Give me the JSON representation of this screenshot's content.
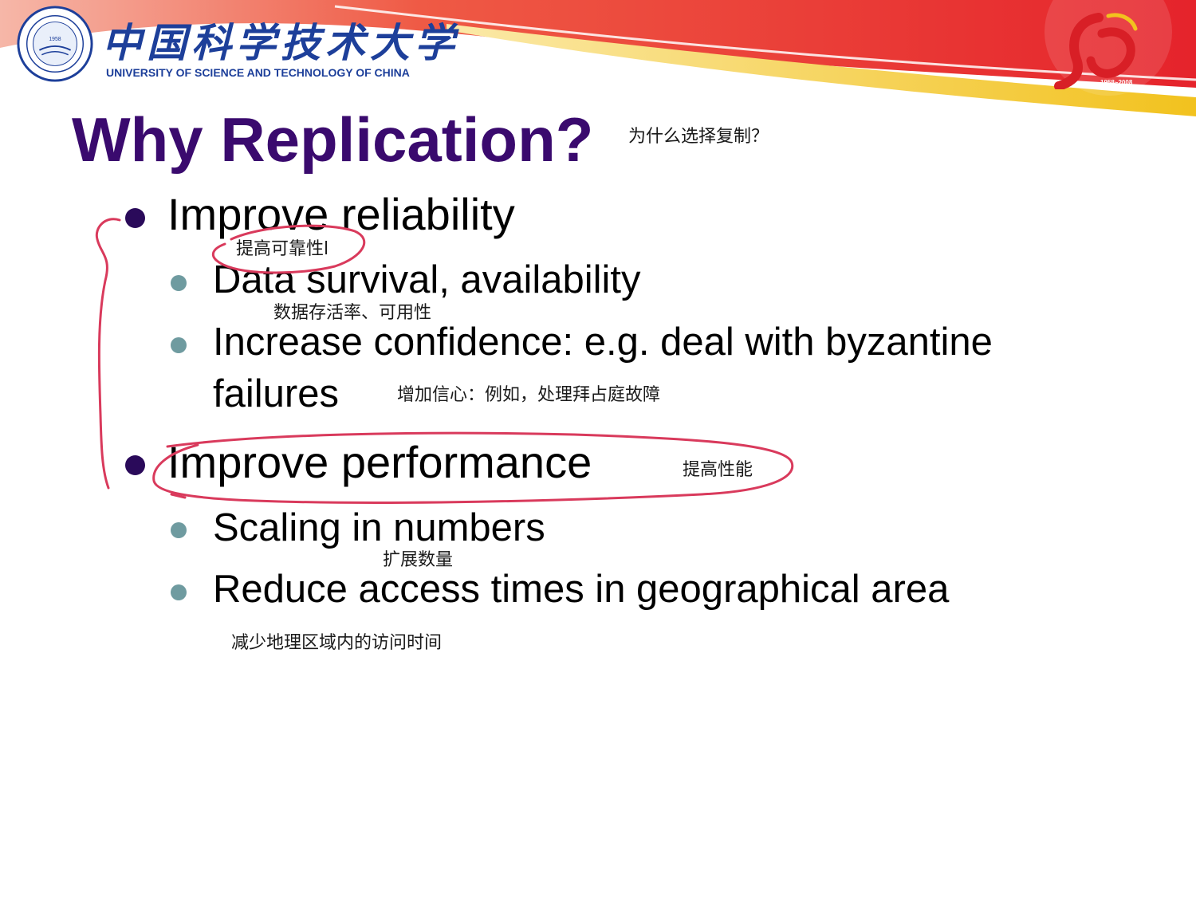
{
  "header": {
    "university_name_cn": "中国科学技术大学",
    "university_name_en": "UNIVERSITY OF SCIENCE AND TECHNOLOGY OF CHINA",
    "seal_year": "1958",
    "anniversary_years": "1958~2008",
    "colors": {
      "brand_blue": "#1d3f9a",
      "banner_red": "#e8262d",
      "banner_gold": "#f3c327"
    }
  },
  "slide": {
    "title": "Why Replication?",
    "title_note": "为什么选择复制？",
    "title_color": "#3a0a6e",
    "points": [
      {
        "text": "Improve reliability",
        "note": "提高可靠性l",
        "subpoints": [
          {
            "text": "Data survival, availability",
            "note": "数据存活率、可用性"
          },
          {
            "text_line1": "Increase confidence: e.g. deal with byzantine",
            "text_line2": "failures",
            "note": "增加信心：例如，处理拜占庭故障"
          }
        ]
      },
      {
        "text": "Improve performance",
        "note": "提高性能",
        "subpoints": [
          {
            "text": "Scaling in numbers",
            "note": "扩展数量"
          },
          {
            "text": "Reduce access times in geographical area",
            "note": "减少地理区域内的访问时间"
          }
        ]
      }
    ]
  },
  "annotations": {
    "ink_color": "#d93a5c"
  }
}
